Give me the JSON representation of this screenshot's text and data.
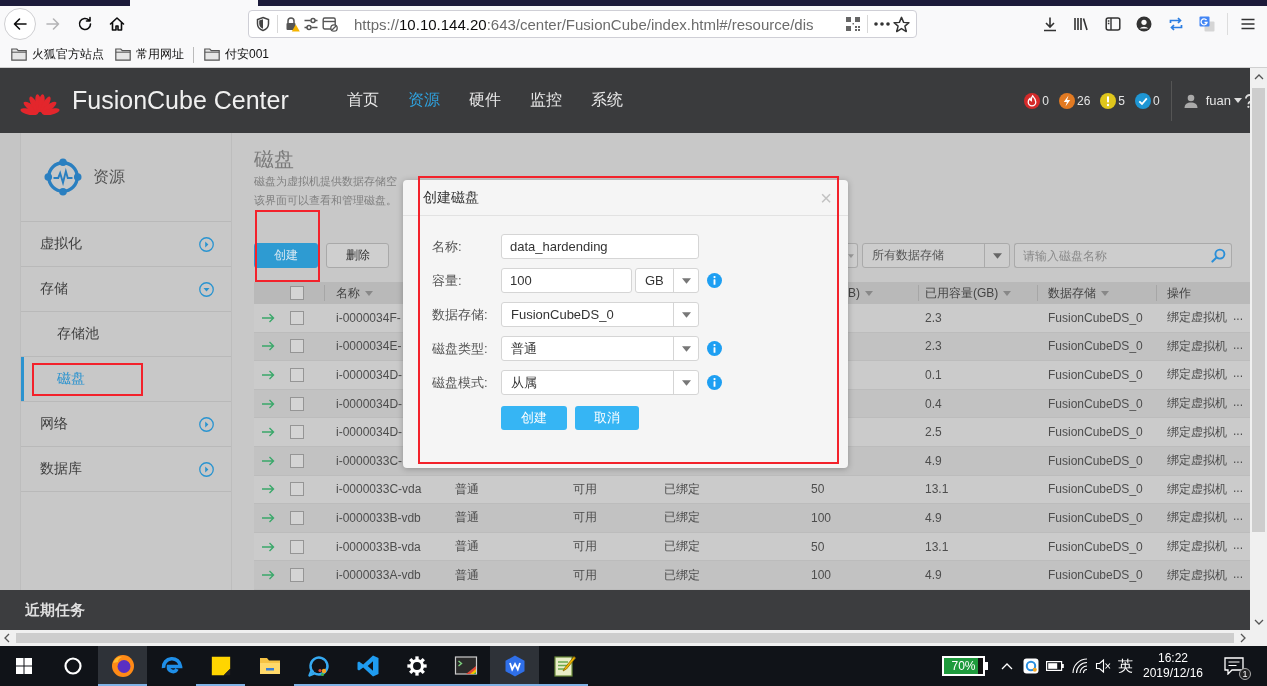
{
  "browser": {
    "nav": [
      {
        "kind": "back",
        "disabled": false
      },
      {
        "kind": "forward",
        "disabled": true
      },
      {
        "kind": "reload",
        "disabled": false
      },
      {
        "kind": "home",
        "disabled": false
      }
    ],
    "url": {
      "scheme": "https://",
      "host": "10.10.144.20",
      "path": ":643/center/FusionCube/index.html#/resource/dis"
    },
    "bookmarks": [
      {
        "kind": "folder",
        "label": "火狐官方站点"
      },
      {
        "kind": "folder",
        "label": "常用网址"
      },
      {
        "kind": "separator"
      },
      {
        "kind": "folder",
        "label": "付安001"
      }
    ]
  },
  "app": {
    "brand": "FusionCube Center",
    "nav": [
      {
        "label": "首页",
        "selected": false
      },
      {
        "label": "资源",
        "selected": true
      },
      {
        "label": "硬件",
        "selected": false
      },
      {
        "label": "监控",
        "selected": false
      },
      {
        "label": "系统",
        "selected": false
      }
    ],
    "alarms": [
      {
        "kind": "critical",
        "color": "#d42a2a",
        "count": "0"
      },
      {
        "kind": "major",
        "color": "#e27a22",
        "count": "26"
      },
      {
        "kind": "minor",
        "color": "#dfc61c",
        "count": "5"
      },
      {
        "kind": "info",
        "color": "#1e96d4",
        "count": "0"
      }
    ],
    "user": "fuan"
  },
  "sidebar": {
    "title": "资源",
    "items": [
      {
        "label": "虚拟化",
        "selected": false,
        "expanded": false
      },
      {
        "label": "存储",
        "selected": false,
        "expanded": true,
        "children": [
          {
            "label": "存储池",
            "selected": false,
            "highlighted": false
          },
          {
            "label": "磁盘",
            "selected": true,
            "highlighted": true
          }
        ]
      },
      {
        "label": "网络",
        "selected": false,
        "expanded": false
      },
      {
        "label": "数据库",
        "selected": false,
        "expanded": false
      }
    ]
  },
  "page": {
    "title": "磁盘",
    "description": [
      "磁盘为虚拟机提供数据存储空",
      "该界面可以查看和管理磁盘。"
    ],
    "toolbar": [
      {
        "kind": "primary",
        "label": "创建",
        "highlighted": true
      },
      {
        "kind": "default",
        "label": "删除",
        "highlighted": false
      }
    ],
    "filters": [
      {
        "kind": "select_cut"
      },
      {
        "kind": "select",
        "value": "所有数据存储"
      }
    ],
    "search": {
      "placeholder": "请输入磁盘名称"
    }
  },
  "table": {
    "select_all": {
      "checked": false
    },
    "columns": [
      {
        "label": "名称",
        "sortable": true
      },
      {
        "label": "B)",
        "sortable": true
      },
      {
        "label": "已用容量(GB)",
        "sortable": true
      },
      {
        "label": "数据存储",
        "sortable": true
      },
      {
        "label": "操作",
        "sortable": false
      }
    ],
    "rows": [
      {
        "checked": false,
        "name": "i-0000034F-",
        "used": "2.3",
        "datastore": "FusionCubeDS_0",
        "action": "绑定虚拟机",
        "more": "..."
      },
      {
        "checked": false,
        "name": "i-0000034E-",
        "used": "2.3",
        "datastore": "FusionCubeDS_0",
        "action": "绑定虚拟机",
        "more": "..."
      },
      {
        "checked": false,
        "name": "i-0000034D-",
        "used": "0.1",
        "datastore": "FusionCubeDS_0",
        "action": "绑定虚拟机",
        "more": "..."
      },
      {
        "checked": false,
        "name": "i-0000034D-",
        "used": "0.4",
        "datastore": "FusionCubeDS_0",
        "action": "绑定虚拟机",
        "more": "..."
      },
      {
        "checked": false,
        "name": "i-0000034D-",
        "used": "2.5",
        "datastore": "FusionCubeDS_0",
        "action": "绑定虚拟机",
        "more": "..."
      },
      {
        "checked": false,
        "name": "i-0000033C-",
        "used": "4.9",
        "datastore": "FusionCubeDS_0",
        "action": "绑定虚拟机",
        "more": "..."
      },
      {
        "checked": false,
        "name": "i-0000033C-vda",
        "column_3": "普通",
        "column_4": "可用",
        "column_5": "已绑定",
        "column_6": "50",
        "used": "13.1",
        "datastore": "FusionCubeDS_0",
        "action": "绑定虚拟机",
        "more": "..."
      },
      {
        "checked": false,
        "name": "i-0000033B-vdb",
        "column_3": "普通",
        "column_4": "可用",
        "column_5": "已绑定",
        "column_6": "100",
        "used": "4.9",
        "datastore": "FusionCubeDS_0",
        "action": "绑定虚拟机",
        "more": "..."
      },
      {
        "checked": false,
        "name": "i-0000033B-vda",
        "column_3": "普通",
        "column_4": "可用",
        "column_5": "已绑定",
        "column_6": "50",
        "used": "13.1",
        "datastore": "FusionCubeDS_0",
        "action": "绑定虚拟机",
        "more": "..."
      },
      {
        "checked": false,
        "name": "i-0000033A-vdb",
        "column_3": "普通",
        "column_4": "可用",
        "column_5": "已绑定",
        "column_6": "100",
        "used": "4.9",
        "datastore": "FusionCubeDS_0",
        "action": "绑定虚拟机",
        "more": "..."
      }
    ]
  },
  "dialog": {
    "title": "创建磁盘",
    "close": "×",
    "highlighted": true,
    "fields": [
      {
        "kind": "text",
        "label": "名称:",
        "value": "data_hardending",
        "info": false
      },
      {
        "kind": "number_unit",
        "label": "容量:",
        "value": "100",
        "unit": "GB",
        "info": true
      },
      {
        "kind": "select",
        "label": "数据存储:",
        "value": "FusionCubeDS_0",
        "info": false
      },
      {
        "kind": "select",
        "label": "磁盘类型:",
        "value": "普通",
        "info": true
      },
      {
        "kind": "select",
        "label": "磁盘模式:",
        "value": "从属",
        "info": true
      }
    ],
    "buttons": [
      {
        "label": "创建"
      },
      {
        "label": "取消"
      }
    ]
  },
  "tasks_bar": {
    "title": "近期任务"
  },
  "taskbar": {
    "apps": [
      {
        "kind": "start",
        "running": false,
        "active": false
      },
      {
        "kind": "search",
        "running": false,
        "active": false
      },
      {
        "kind": "firefox",
        "running": true,
        "active": true
      },
      {
        "kind": "edge",
        "running": false,
        "active": false
      },
      {
        "kind": "notes",
        "running": true,
        "active": false
      },
      {
        "kind": "files",
        "running": false,
        "active": false
      },
      {
        "kind": "chat",
        "running": true,
        "active": false
      },
      {
        "kind": "code",
        "running": true,
        "active": false
      },
      {
        "kind": "settings",
        "running": true,
        "active": false
      },
      {
        "kind": "terminal",
        "running": true,
        "active": false
      },
      {
        "kind": "wps",
        "running": true,
        "active": true
      },
      {
        "kind": "notepad",
        "running": true,
        "active": false
      }
    ],
    "tray": {
      "battery": "70%",
      "ime": "英",
      "time": "16:22",
      "date": "2019/12/16",
      "notifications": "1"
    }
  }
}
